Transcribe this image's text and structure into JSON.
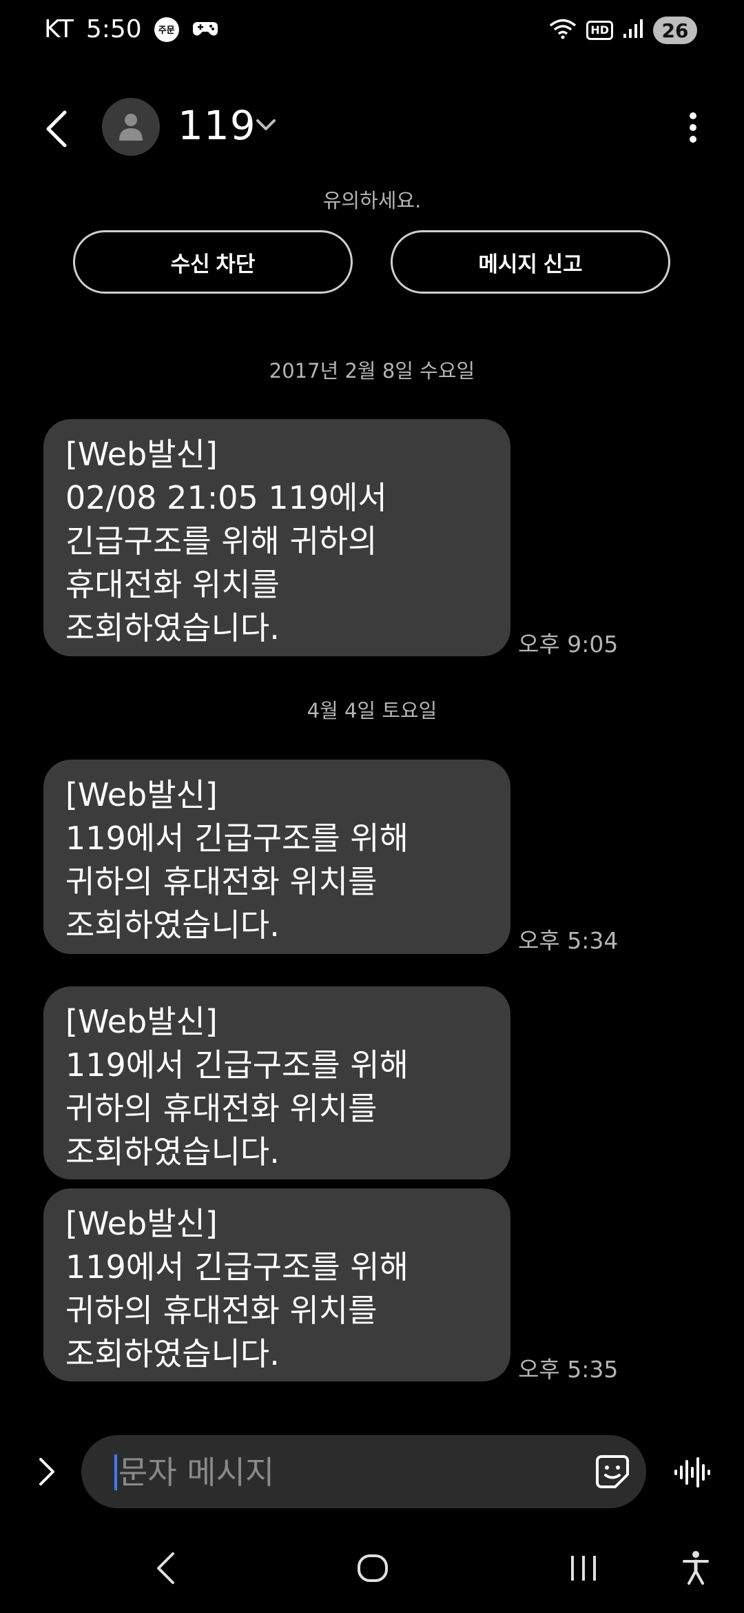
{
  "status_bar": {
    "carrier": "KT",
    "time": "5:50",
    "badge_text": "주문",
    "hd_label": "HD",
    "battery": "26",
    "icons": [
      "order-badge-icon",
      "game-controller-icon",
      "wifi-icon",
      "hd-voice-icon",
      "signal-icon",
      "battery-icon"
    ]
  },
  "header": {
    "contact_name": "119",
    "icons": [
      "back-arrow-icon",
      "person-icon",
      "chevron-down-icon",
      "more-vertical-icon"
    ]
  },
  "caution": "유의하세요.",
  "actions": {
    "block_label": "수신 차단",
    "report_label": "메시지 신고"
  },
  "conversation": {
    "date_1": "2017년 2월 8일 수요일",
    "date_2": "4월 4일 토요일",
    "messages": [
      {
        "lines": [
          "[Web발신]",
          "02/08 21:05 119에서",
          "긴급구조를 위해 귀하의",
          "휴대전화 위치를",
          "조회하였습니다."
        ],
        "time": "오후 9:05"
      },
      {
        "lines": [
          "[Web발신]",
          "119에서 긴급구조를 위해",
          "귀하의 휴대전화 위치를",
          "조회하였습니다."
        ],
        "time": "오후 5:34"
      },
      {
        "lines": [
          "[Web발신]",
          "119에서 긴급구조를 위해",
          "귀하의 휴대전화 위치를",
          "조회하였습니다."
        ],
        "time": ""
      },
      {
        "lines": [
          "[Web발신]",
          "119에서 긴급구조를 위해",
          "귀하의 휴대전화 위치를",
          "조회하였습니다."
        ],
        "time": "오후 5:35"
      }
    ]
  },
  "composer": {
    "placeholder": "문자 메시지",
    "icons": [
      "expand-chevron-icon",
      "emoji-sticker-icon",
      "voice-waveform-icon"
    ]
  },
  "nav_bar": {
    "icons": [
      "nav-back-icon",
      "nav-home-icon",
      "nav-recents-icon",
      "accessibility-icon"
    ]
  },
  "colors": {
    "background": "#000000",
    "bubble": "#3c3c3c",
    "secondary_text": "#b5b5b5",
    "input_background": "#2c2c2c",
    "cursor": "#3d7bff"
  }
}
